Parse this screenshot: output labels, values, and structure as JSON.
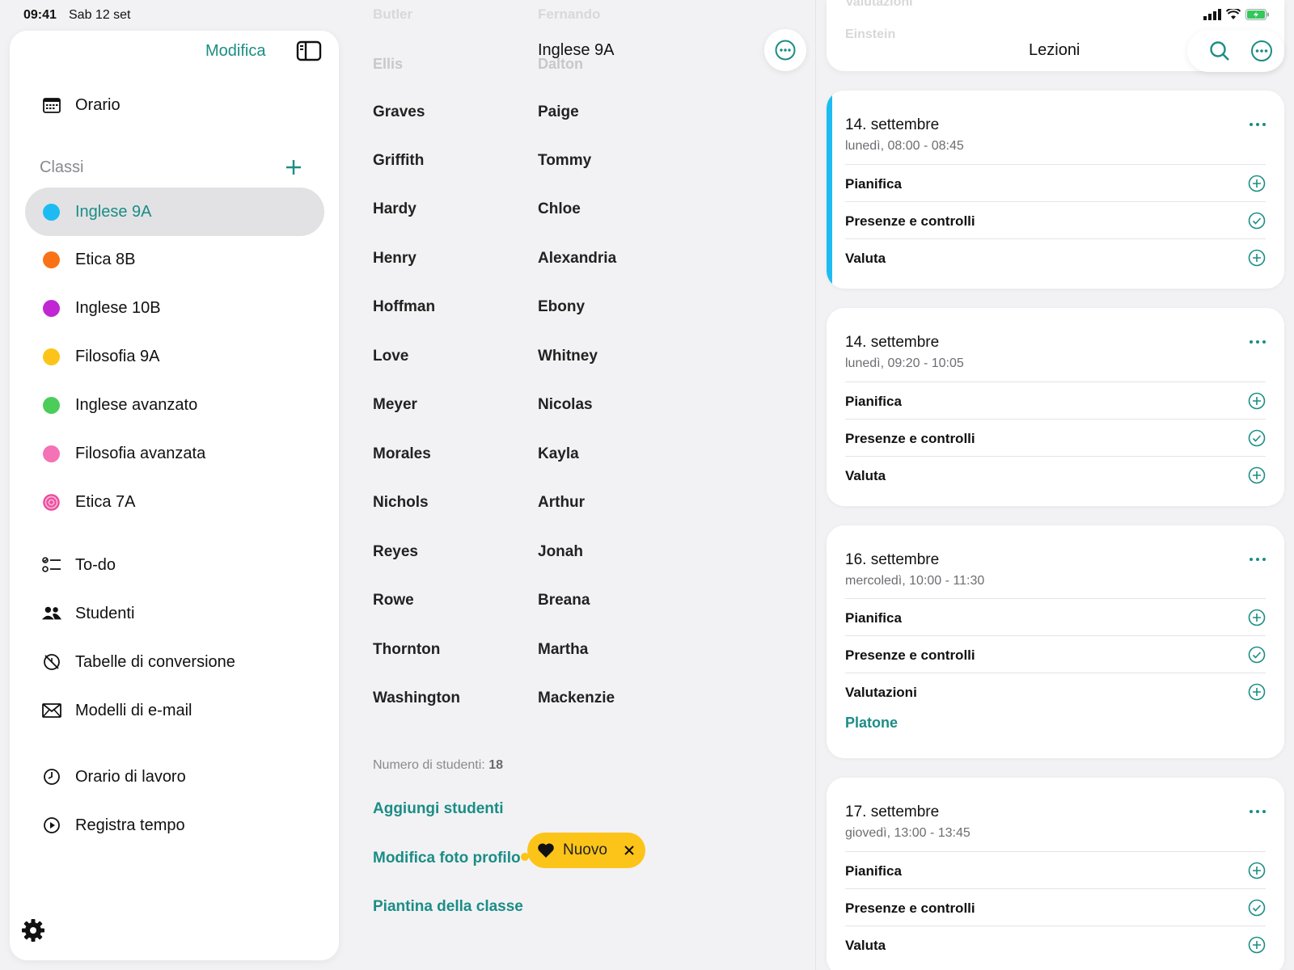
{
  "status_bar": {
    "time": "09:41",
    "date": "Sab 12 set"
  },
  "sidebar": {
    "edit_label": "Modifica",
    "schedule_label": "Orario",
    "classes_section": "Classi",
    "classes": [
      {
        "label": "Inglese 9A",
        "color": "#1cbcf2",
        "active": true
      },
      {
        "label": "Etica 8B",
        "color": "#f97316"
      },
      {
        "label": "Inglese 10B",
        "color": "#c026d3"
      },
      {
        "label": "Filosofia 9A",
        "color": "#fcc419"
      },
      {
        "label": "Inglese avanzato",
        "color": "#4ccd5a"
      },
      {
        "label": "Filosofia avanzata",
        "color": "#f472b6"
      },
      {
        "label": "Etica 7A",
        "color": "#ec4899"
      }
    ],
    "tools": [
      {
        "label": "To-do",
        "icon": "todo-list-icon"
      },
      {
        "label": "Studenti",
        "icon": "students-icon"
      },
      {
        "label": "Tabelle di conversione",
        "icon": "conversion-table-icon"
      },
      {
        "label": "Modelli di e-mail",
        "icon": "envelope-icon"
      }
    ],
    "time": [
      {
        "label": "Orario di lavoro",
        "icon": "clock-icon"
      },
      {
        "label": "Registra tempo",
        "icon": "play-icon"
      }
    ]
  },
  "class_view": {
    "title": "Inglese 9A",
    "ghost_rows": [
      {
        "last": "Butler",
        "first": "Fernando"
      },
      {
        "last": "Ellis",
        "first": "Dalton"
      }
    ],
    "students": [
      {
        "last": "Graves",
        "first": "Paige"
      },
      {
        "last": "Griffith",
        "first": "Tommy"
      },
      {
        "last": "Hardy",
        "first": "Chloe"
      },
      {
        "last": "Henry",
        "first": "Alexandria"
      },
      {
        "last": "Hoffman",
        "first": "Ebony"
      },
      {
        "last": "Love",
        "first": "Whitney"
      },
      {
        "last": "Meyer",
        "first": "Nicolas"
      },
      {
        "last": "Morales",
        "first": "Kayla"
      },
      {
        "last": "Nichols",
        "first": "Arthur"
      },
      {
        "last": "Reyes",
        "first": "Jonah"
      },
      {
        "last": "Rowe",
        "first": "Breana"
      },
      {
        "last": "Thornton",
        "first": "Martha"
      },
      {
        "last": "Washington",
        "first": "Mackenzie"
      }
    ],
    "count_label": "Numero di studenti:",
    "count_value": "18",
    "add_students": "Aggiungi studenti",
    "edit_photo": "Modifica foto profilo",
    "seating_plan": "Piantina della classe",
    "new_badge": "Nuovo"
  },
  "lessons": {
    "title": "Lezioni",
    "ghost_top": [
      "Valutazioni",
      "Einstein"
    ],
    "cards": [
      {
        "date": "14. settembre",
        "time": "lunedì, 08:00 - 08:45",
        "rows": [
          {
            "label": "Pianifica",
            "icon": "plus-circle-icon"
          },
          {
            "label": "Presenze e controlli",
            "icon": "check-circle-icon"
          },
          {
            "label": "Valuta",
            "icon": "plus-circle-icon"
          }
        ]
      },
      {
        "date": "14. settembre",
        "time": "lunedì, 09:20 - 10:05",
        "rows": [
          {
            "label": "Pianifica",
            "icon": "plus-circle-icon"
          },
          {
            "label": "Presenze e controlli",
            "icon": "check-circle-icon"
          },
          {
            "label": "Valuta",
            "icon": "plus-circle-icon"
          }
        ]
      },
      {
        "date": "16. settembre",
        "time": "mercoledì, 10:00 - 11:30",
        "rows": [
          {
            "label": "Pianifica",
            "icon": "plus-circle-icon"
          },
          {
            "label": "Presenze e controlli",
            "icon": "check-circle-icon"
          },
          {
            "label": "Valutazioni",
            "icon": "plus-circle-icon"
          }
        ],
        "extra": "Platone"
      },
      {
        "date": "17. settembre",
        "time": "giovedì, 13:00 - 13:45",
        "rows": [
          {
            "label": "Pianifica",
            "icon": "plus-circle-icon"
          },
          {
            "label": "Presenze e controlli",
            "icon": "check-circle-icon"
          },
          {
            "label": "Valuta",
            "icon": "plus-circle-icon"
          }
        ]
      }
    ]
  },
  "colors": {
    "accent": "#1b8d86",
    "highlight": "#fcc419",
    "active_class": "#1cbcf2"
  }
}
